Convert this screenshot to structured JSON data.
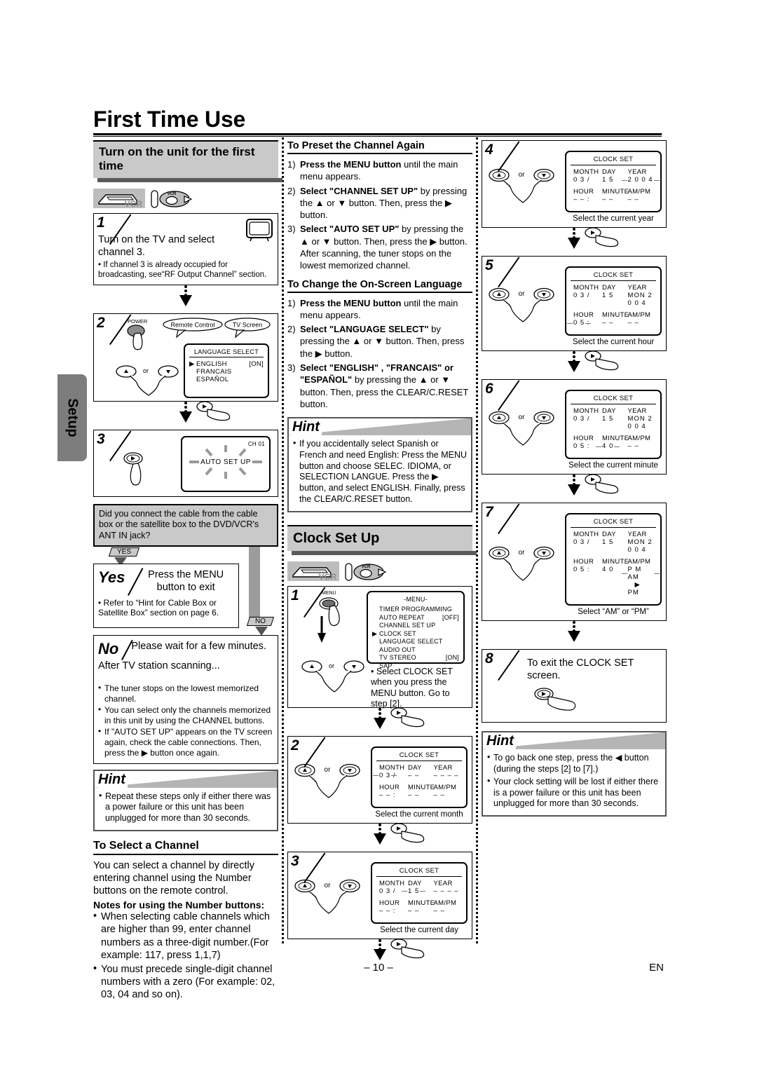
{
  "page": {
    "title": "First Time Use",
    "side_tab": "Setup",
    "page_number": "– 10 –",
    "lang_code": "EN"
  },
  "col1": {
    "section_title": "Turn on the unit for the first time",
    "device_icons": {
      "vcr": "VCR",
      "dvd": "DVD",
      "dvd_badge": "VCR"
    },
    "step1": {
      "num": "1",
      "text": "Turn on the TV and select channel 3.",
      "note": "• If channel 3 is already occupied for broadcasting, see“RF Output Channel” section.",
      "icon": "tv-icon"
    },
    "step2": {
      "num": "2",
      "power_label": "POWER",
      "callout_remote": "Remote Control",
      "callout_tv": "TV Screen",
      "osd_title": "LANGUAGE SELECT",
      "osd_items": [
        {
          "cursor": "▶",
          "label": "ENGLISH",
          "value": "[ON]"
        },
        {
          "cursor": "",
          "label": "FRANCAIS",
          "value": ""
        },
        {
          "cursor": "",
          "label": "ESPAÑOL",
          "value": ""
        }
      ],
      "updown_or": "or"
    },
    "step3": {
      "num": "3",
      "osd_channel": "CH 01",
      "osd_text": "AUTO SET UP"
    },
    "decision": {
      "question": "Did you connect the cable from the cable box or the satellite box to the DVD/VCR's ANT IN jack?",
      "yes_tag": "YES",
      "no_tag": "NO"
    },
    "yes_box": {
      "label": "Yes",
      "text": "Press the MENU button to exit",
      "note": "• Refer to “Hint for Cable Box or Satellite Box” section on page 6."
    },
    "no_box": {
      "label": "No",
      "text": "Please wait for a few minutes.",
      "text2": "After TV station scanning...",
      "bullets": [
        "The tuner stops on the lowest memorized channel.",
        "You can select only the channels memorized in this unit by using the CHANNEL buttons.",
        "If \"AUTO SET UP\" appears on the TV screen again, check the cable connections. Then, press the ▶ button once again."
      ]
    },
    "hint": {
      "word": "Hint",
      "bullets": [
        "Repeat these steps only if either there was a power failure or this unit has been unplugged for more than 30 seconds."
      ]
    },
    "select_channel": {
      "heading": "To Select a Channel",
      "body": "You can select a channel by directly entering channel using the Number buttons on the remote control.",
      "notes_heading": "Notes for using the Number buttons:",
      "bullets": [
        "When selecting cable channels which are higher than 99, enter channel numbers as a three-digit number.(For example: 117, press 1,1,7)",
        "You must precede single-digit channel numbers with a zero (For example: 02, 03, 04 and so on)."
      ]
    }
  },
  "col2": {
    "preset": {
      "heading": "To Preset the Channel Again",
      "items": [
        {
          "num": "1)",
          "bold": "Press the MENU button",
          "rest": " until the main menu appears."
        },
        {
          "num": "2)",
          "bold": "Select \"CHANNEL SET UP\"",
          "rest": " by pressing the ▲ or ▼ button. Then, press the ▶ button."
        },
        {
          "num": "3)",
          "bold": "Select \"AUTO SET UP\"",
          "rest": " by pressing the ▲ or ▼ button. Then, press the ▶ button. After scanning, the tuner stops on the lowest memorized channel."
        }
      ]
    },
    "language": {
      "heading": "To Change the On-Screen Language",
      "items": [
        {
          "num": "1)",
          "bold": "Press the MENU button",
          "rest": " until the main menu appears."
        },
        {
          "num": "2)",
          "bold": "Select \"LANGUAGE SELECT\"",
          "rest": " by pressing the ▲ or ▼ button. Then, press the ▶ button."
        },
        {
          "num": "3)",
          "bold": "Select \"ENGLISH\" , \"FRANCAIS\" or \"ESPAÑOL\"",
          "rest": " by pressing the ▲ or ▼ button. Then, press the CLEAR/C.RESET button."
        }
      ]
    },
    "hint": {
      "word": "Hint",
      "bullets": [
        "If you accidentally select Spanish or French and need English: Press the MENU button and choose SELEC. IDIOMA, or SELECTION LANGUE. Press the ▶ button, and select ENGLISH. Finally, press the CLEAR/C.RESET button."
      ]
    },
    "clock_section_title": "Clock Set Up",
    "device_icons": {
      "vcr": "VCR",
      "dvd": "DVD",
      "dvd_badge": "VCR"
    },
    "step1": {
      "num": "1",
      "menu_label": "MENU",
      "osd_title": "-MENU-",
      "osd_items": [
        {
          "cursor": "",
          "label": "TIMER PROGRAMMING",
          "value": ""
        },
        {
          "cursor": "",
          "label": "AUTO REPEAT",
          "value": "[OFF]"
        },
        {
          "cursor": "",
          "label": "CHANNEL SET UP",
          "value": ""
        },
        {
          "cursor": "▶",
          "label": "CLOCK SET",
          "value": ""
        },
        {
          "cursor": "",
          "label": "LANGUAGE SELECT",
          "value": ""
        },
        {
          "cursor": "",
          "label": "AUDIO OUT",
          "value": ""
        },
        {
          "cursor": "",
          "label": "TV STEREO",
          "value": "[ON]"
        },
        {
          "cursor": "",
          "label": "SAP",
          "value": ""
        }
      ],
      "note": "• Select CLOCK SET when you press the MENU button. Go to step [2].",
      "updown_or": "or"
    },
    "step2": {
      "num": "2",
      "updown_or": "or",
      "osd_title": "CLOCK SET",
      "labels_top": [
        "MONTH",
        "DAY",
        "YEAR"
      ],
      "vals_top": [
        "0 3",
        "/",
        "– –",
        "– – – –"
      ],
      "labels_bot": [
        "HOUR",
        "MINUTE",
        "AM/PM"
      ],
      "vals_bot": [
        "– –",
        ":",
        "– –",
        "– –"
      ],
      "blink_field": "month",
      "caption": "Select the current month"
    },
    "step3": {
      "num": "3",
      "updown_or": "or",
      "osd_title": "CLOCK SET",
      "labels_top": [
        "MONTH",
        "DAY",
        "YEAR"
      ],
      "vals_top": [
        "0 3",
        "/",
        "1 5",
        "– – – –"
      ],
      "labels_bot": [
        "HOUR",
        "MINUTE",
        "AM/PM"
      ],
      "vals_bot": [
        "– –",
        ":",
        "– –",
        "– –"
      ],
      "blink_field": "day",
      "caption": "Select the current day"
    }
  },
  "col3": {
    "step4": {
      "num": "4",
      "updown_or": "or",
      "osd_title": "CLOCK SET",
      "labels_top": [
        "MONTH",
        "DAY",
        "YEAR"
      ],
      "vals_top": [
        "0 3",
        "/",
        "1 5",
        "2 0 0 4"
      ],
      "labels_bot": [
        "HOUR",
        "MINUTE",
        "AM/PM"
      ],
      "vals_bot": [
        "– –",
        ":",
        "– –",
        "– –"
      ],
      "blink_field": "year",
      "caption": "Select the current year"
    },
    "step5": {
      "num": "5",
      "updown_or": "or",
      "osd_title": "CLOCK SET",
      "labels_top": [
        "MONTH",
        "DAY",
        "YEAR"
      ],
      "vals_top": [
        "0 3",
        "/",
        "1 5",
        "MON  2 0 0 4"
      ],
      "labels_bot": [
        "HOUR",
        "MINUTE",
        "AM/PM"
      ],
      "vals_bot": [
        "0 5",
        ":",
        "– –",
        "– –"
      ],
      "blink_field": "hour",
      "caption": "Select the current hour"
    },
    "step6": {
      "num": "6",
      "updown_or": "or",
      "osd_title": "CLOCK SET",
      "labels_top": [
        "MONTH",
        "DAY",
        "YEAR"
      ],
      "vals_top": [
        "0 3",
        "/",
        "1 5",
        "MON  2 0 0 4"
      ],
      "labels_bot": [
        "HOUR",
        "MINUTE",
        "AM/PM"
      ],
      "vals_bot": [
        "0 5",
        ":",
        "4 0",
        "– –"
      ],
      "blink_field": "minute",
      "caption": "Select the current minute"
    },
    "step7": {
      "num": "7",
      "updown_or": "or",
      "osd_title": "CLOCK SET",
      "labels_top": [
        "MONTH",
        "DAY",
        "YEAR"
      ],
      "vals_top": [
        "0 3",
        "/",
        "1 5",
        "MON 2 0 0 4"
      ],
      "labels_bot": [
        "HOUR",
        "MINUTE",
        "AM/PM"
      ],
      "vals_bot": [
        "0 5",
        ":",
        "4 0",
        "P M  AM"
      ],
      "ampm_second": "▶ PM",
      "blink_field": "ampm",
      "caption": "Select “AM” or “PM”"
    },
    "step8": {
      "num": "8",
      "text": "To exit the CLOCK SET screen."
    },
    "hint": {
      "word": "Hint",
      "bullets": [
        "To go back one step, press the ◀ button (during the steps [2] to [7].)",
        "Your clock setting will be lost if either there is a power failure or this unit has been unplugged for more than 30 seconds."
      ]
    }
  }
}
